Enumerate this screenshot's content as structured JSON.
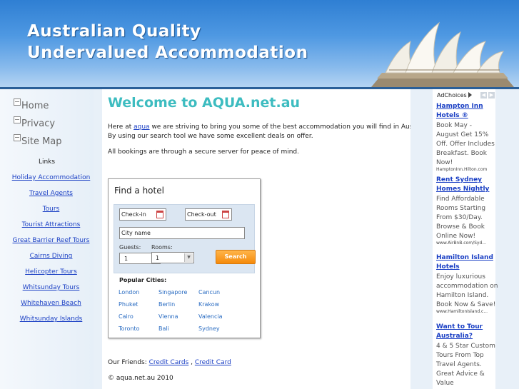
{
  "header": {
    "title_line1": "Australian Quality",
    "title_line2": "Undervalued Accommodation"
  },
  "sidebar": {
    "nav": [
      {
        "label": "Home"
      },
      {
        "label": "Privacy"
      },
      {
        "label": "Site Map"
      }
    ],
    "links_heading": "Links",
    "links": [
      "Holiday Accommodation",
      "Travel Agents",
      "Tours",
      "Tourist Attractions",
      "Great Barrier Reef Tours",
      "Cairns Diving",
      "Helicopter Tours",
      "Whitsunday Tours",
      "Whitehaven Beach",
      "Whitsunday Islands"
    ]
  },
  "main": {
    "welcome": "Welcome to AQUA.net.au",
    "intro_prefix": "Here at ",
    "intro_link": "aqua",
    "intro_suffix": " we are striving to bring you some of the best accommodation you will find in Australia.",
    "intro_line2": "By using our search tool we have some excellent deals on offer.",
    "secure": "All bookings are through a secure server for peace of mind.",
    "friends_label": "Our Friends: ",
    "friends_link1": "Credit Cards",
    "friends_sep": " , ",
    "friends_link2": "Credit Card",
    "copyright": "© aqua.net.au   2010"
  },
  "hotel_widget": {
    "title": "Find a hotel",
    "checkin_placeholder": "Check-in",
    "checkout_placeholder": "Check-out",
    "city_placeholder": "City name",
    "guests_label": "Guests:",
    "rooms_label": "Rooms:",
    "guests_value": "1",
    "rooms_value": "1",
    "search_label": "Search",
    "popular_heading": "Popular Cities:",
    "cities": [
      [
        "London",
        "Singapore",
        "Cancun"
      ],
      [
        "Phuket",
        "Berlin",
        "Krakow"
      ],
      [
        "Cairo",
        "Vienna",
        "Valencia"
      ],
      [
        "Toronto",
        "Bali",
        "Sydney"
      ]
    ]
  },
  "ads": {
    "adchoices": "AdChoices",
    "items": [
      {
        "title": [
          "Hampton Inn",
          "Hotels ®"
        ],
        "body": [
          "Book May -",
          "August Get 15%",
          "Off. Offer Includes",
          "Breakfast. Book",
          "Now!"
        ],
        "url": "HamptonInn.Hilton.com"
      },
      {
        "title": [
          "Rent Sydney",
          "Homes Nightly"
        ],
        "body": [
          "Find Affordable",
          "Rooms Starting",
          "From $30/Day.",
          "Browse & Book",
          "Online Now!"
        ],
        "url": "www.AirBnB.com/Syd..."
      },
      {
        "title": [
          "Hamilton Island",
          "Hotels"
        ],
        "body": [
          "Enjoy luxurious",
          "accommodation on",
          "Hamilton Island.",
          "Book Now & Save!"
        ],
        "url": "www.HamiltonIsland.c..."
      },
      {
        "title": [
          "Want to Tour",
          "Australia?"
        ],
        "body": [
          "4 & 5 Star Custom",
          "Tours From Top",
          "Travel Agents.",
          "Great Advice &",
          "Value"
        ],
        "url": ""
      }
    ]
  }
}
